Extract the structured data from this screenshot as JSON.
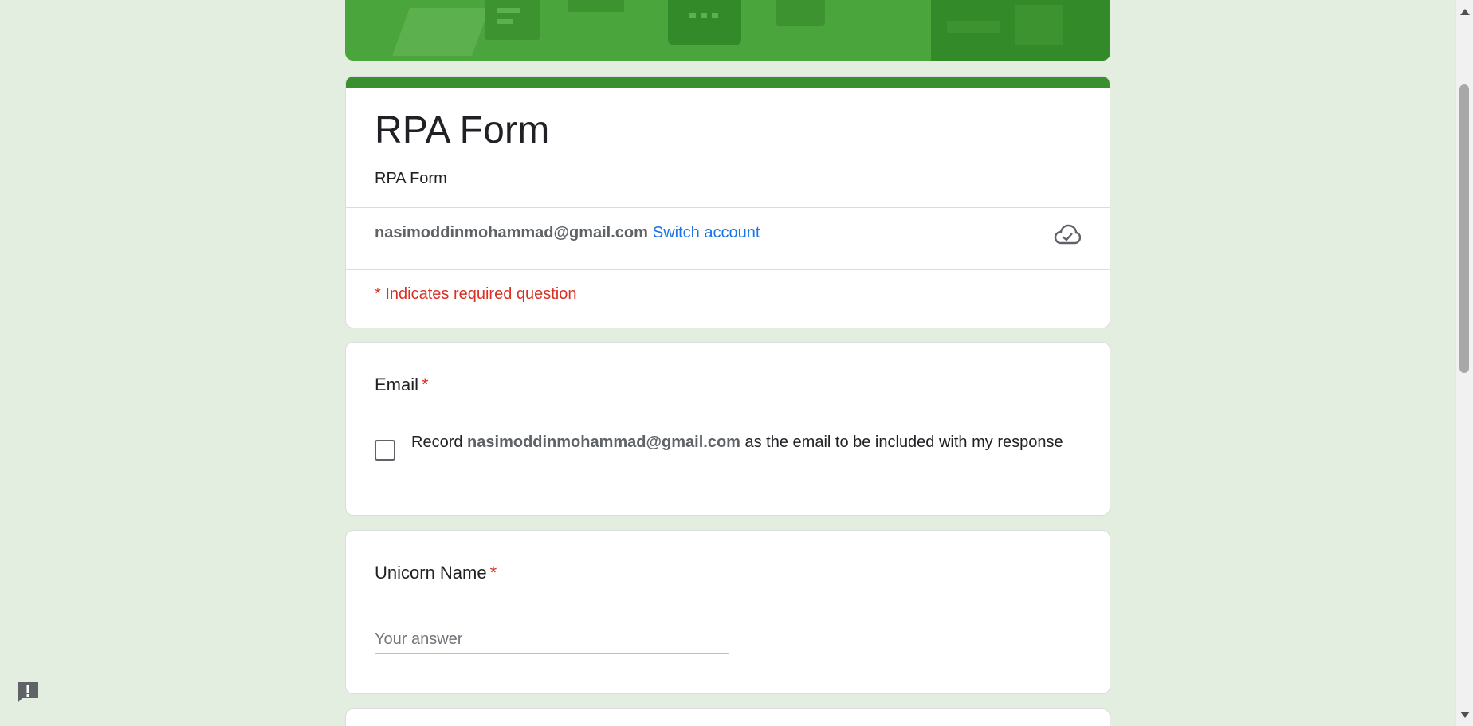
{
  "form": {
    "title": "RPA Form",
    "description": "RPA Form"
  },
  "account": {
    "email": "nasimoddinmohammad@gmail.com",
    "switch_label": "Switch account",
    "status_icon": "cloud-check-icon"
  },
  "required_note": "* Indicates required question",
  "questions": {
    "email": {
      "title": "Email",
      "required_mark": "*",
      "checkbox_prefix": "Record",
      "checkbox_email": "nasimoddinmohammad@gmail.com",
      "checkbox_suffix": "as the email to be included with my response",
      "checked": false
    },
    "unicorn_name": {
      "title": "Unicorn Name",
      "required_mark": "*",
      "placeholder": "Your answer",
      "value": ""
    }
  },
  "colors": {
    "theme": "#4aa53c",
    "theme_dark": "#3a8f2f",
    "background": "#e3eee0",
    "required": "#d93025",
    "link": "#1a73e8"
  },
  "report_icon": "report-issue-icon"
}
